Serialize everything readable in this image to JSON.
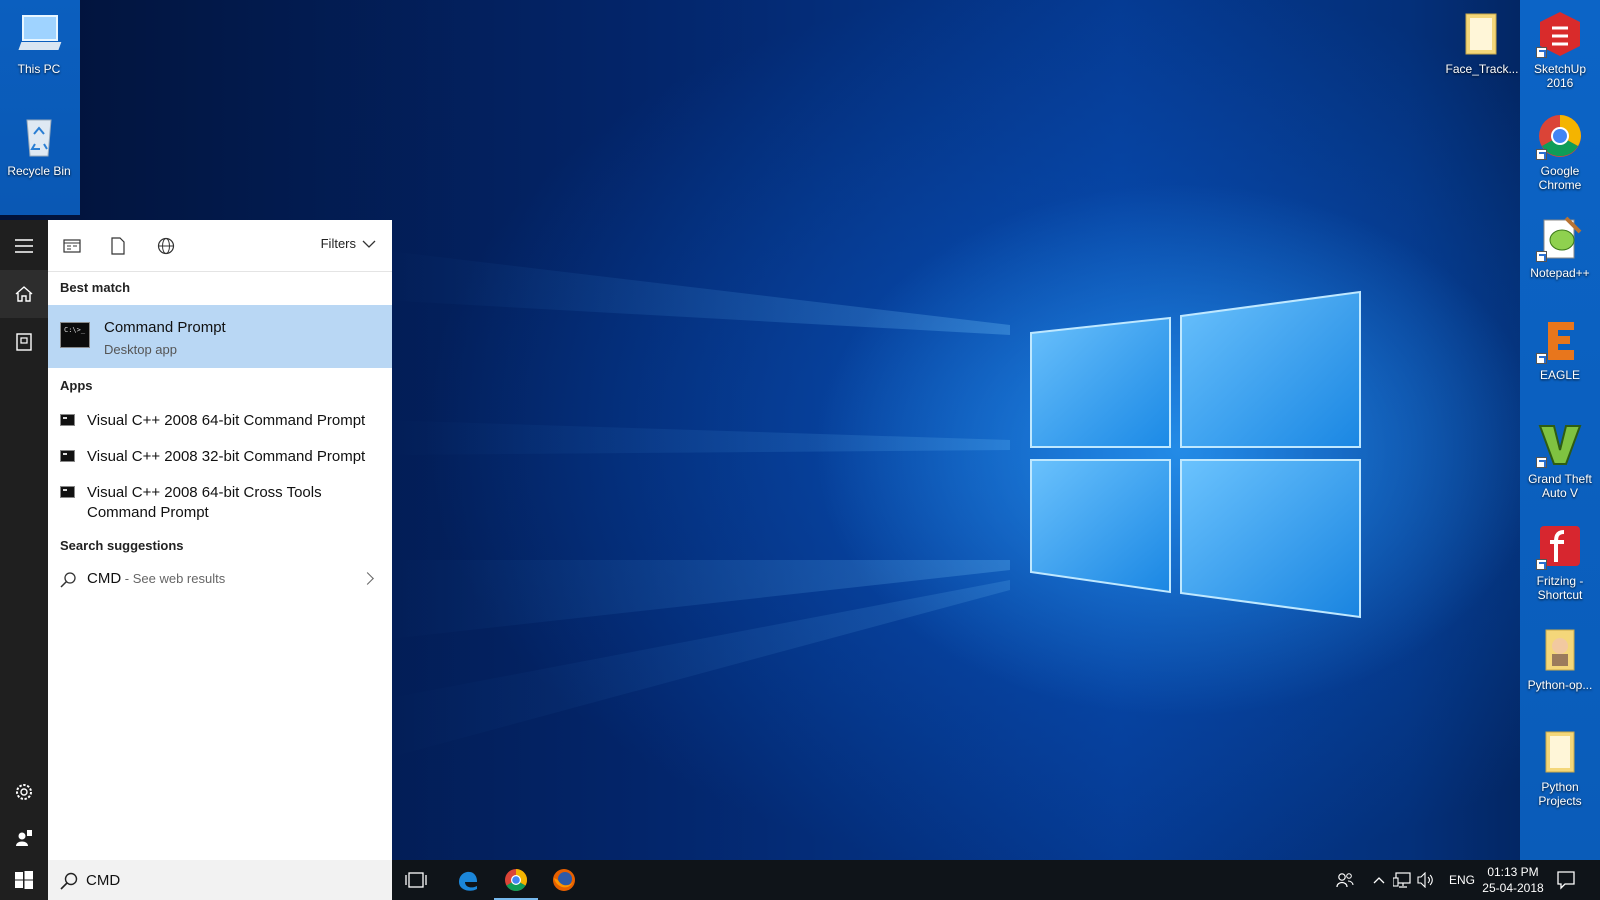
{
  "desktop": {
    "left_icons": [
      {
        "label": "This PC",
        "icon": "computer-icon"
      },
      {
        "label": "Recycle Bin",
        "icon": "recycle-bin-icon"
      }
    ],
    "right_icons": [
      {
        "label": "Face_Track...",
        "icon": "folder-icon"
      },
      {
        "label": "SketchUp 2016",
        "icon": "sketchup-icon"
      },
      {
        "label": "Google Chrome",
        "icon": "chrome-icon"
      },
      {
        "label": "Notepad++",
        "icon": "notepadpp-icon"
      },
      {
        "label": "EAGLE",
        "icon": "eagle-icon"
      },
      {
        "label": "Grand Theft Auto V",
        "icon": "gta-icon"
      },
      {
        "label": "Fritzing - Shortcut",
        "icon": "fritzing-icon"
      },
      {
        "label": "Python-op...",
        "icon": "folder-icon"
      },
      {
        "label": "Python Projects",
        "icon": "folder-icon"
      }
    ]
  },
  "search_panel": {
    "filters_label": "Filters",
    "best_match_heading": "Best match",
    "best_match": {
      "title": "Command Prompt",
      "subtitle": "Desktop app"
    },
    "apps_heading": "Apps",
    "apps": [
      {
        "label": "Visual C++ 2008 64-bit Command Prompt"
      },
      {
        "label": "Visual C++ 2008 32-bit Command Prompt"
      },
      {
        "label": "Visual C++ 2008 64-bit Cross Tools Command Prompt"
      }
    ],
    "suggestions_heading": "Search suggestions",
    "suggestion": {
      "query": "CMD",
      "hint": " - See web results"
    },
    "search_value": "CMD"
  },
  "taskbar": {
    "language": "ENG",
    "time": "01:13 PM",
    "date": "25-04-2018"
  }
}
